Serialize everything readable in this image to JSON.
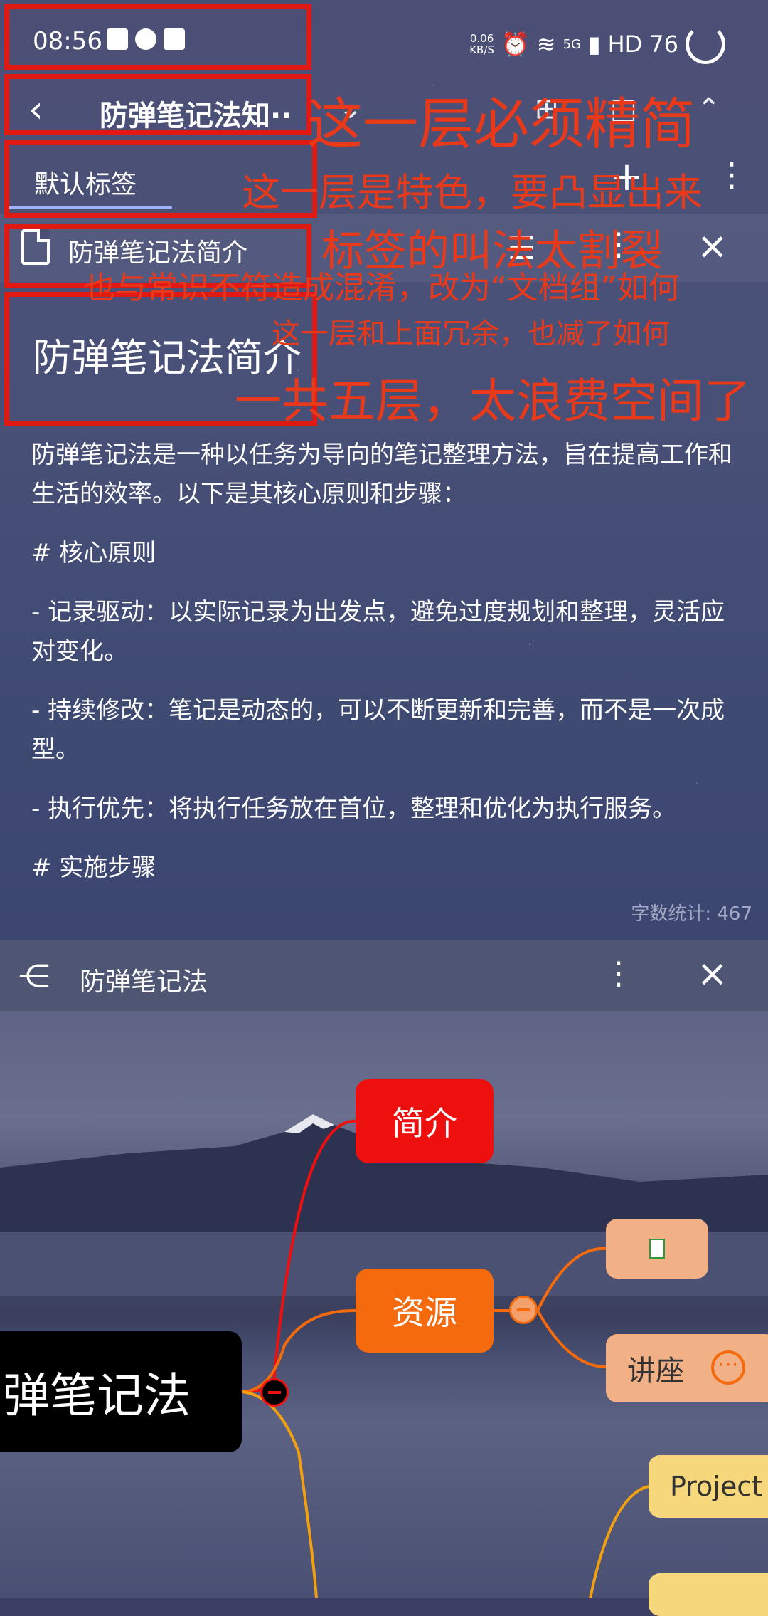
{
  "status_bar": {
    "time": "08:56",
    "net_speed_value": "0.06",
    "net_speed_unit": "KB/S",
    "network": "5G",
    "hd": "HD",
    "battery": "76"
  },
  "nav": {
    "title": "防弹笔记法知··"
  },
  "tabs": {
    "active_label": "默认标签"
  },
  "doc": {
    "header_label": "防弹笔记法简介",
    "title": "防弹笔记法简介",
    "paragraphs": [
      "防弹笔记法是一种以任务为导向的笔记整理方法，旨在提高工作和生活的效率。以下是其核心原则和步骤：",
      "# 核心原则",
      "- 记录驱动：以实际记录为出发点，避免过度规划和整理，灵活应对变化。",
      "- 持续修改：笔记是动态的，可以不断更新和完善，而不是一次成型。",
      "- 执行优先：将执行任务放在首位，整理和优化为执行服务。",
      "# 实施步骤"
    ],
    "word_count": "字数统计: 467"
  },
  "mindmap": {
    "header_label": "防弹笔记法",
    "root": "弹笔记法",
    "nodes": {
      "jianjie": "简介",
      "ziyuan": "资源",
      "jiangzuo": "讲座",
      "project": "Project"
    },
    "colors": {
      "branch1": "#ee0f0f",
      "branch2": "#f46a0c",
      "branch3": "#f0a010"
    }
  },
  "annotations": {
    "note1": "这一层必须精简",
    "note2": "这一层是特色，要凸显出来",
    "note3": "标签的叫法太割裂",
    "note4": "也与常识不符造成混淆，改为“文档组”如何",
    "note5": "这一层和上面冗余，也减了如何",
    "note6": "一共五层，太浪费空间了"
  },
  "icons": [
    "back-icon",
    "collapse-icon",
    "window-icon",
    "chevron-up-icon",
    "plus-icon",
    "more-icon",
    "document-icon",
    "outline-icon",
    "close-icon",
    "mindmap-icon"
  ]
}
